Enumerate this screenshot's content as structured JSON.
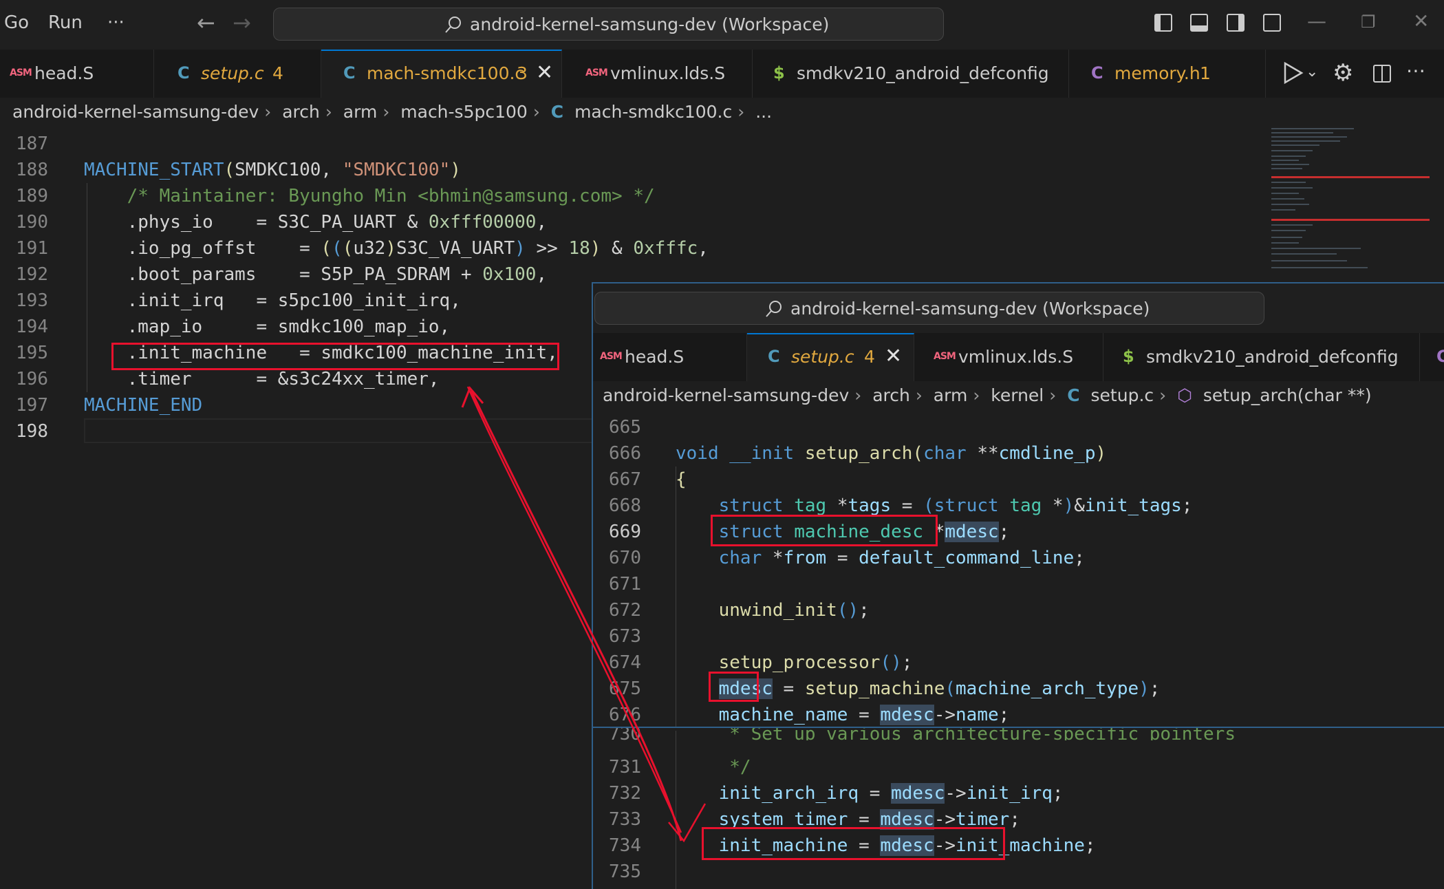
{
  "titlebar": {
    "menu": [
      "Go",
      "Run",
      "···"
    ],
    "back_icon": "arrow-left-icon",
    "forward_icon": "arrow-right-icon",
    "search_text": "android-kernel-samsung-dev (Workspace)"
  },
  "main_editor": {
    "tabs": [
      {
        "icon": "ASM",
        "label": "head.S",
        "badge": ""
      },
      {
        "icon": "C",
        "label": "setup.c",
        "badge": "4"
      },
      {
        "icon": "C",
        "label": "mach-smdkc100.c",
        "badge": "3"
      },
      {
        "icon": "ASM",
        "label": "vmlinux.lds.S",
        "badge": ""
      },
      {
        "icon": "$",
        "label": "smdkv210_android_defconfig",
        "badge": ""
      },
      {
        "icon": "C",
        "label": "memory.h",
        "badge": "1"
      }
    ],
    "breadcrumbs": [
      "android-kernel-samsung-dev",
      "arch",
      "arm",
      "mach-s5pc100",
      "C",
      "mach-smdkc100.c",
      "..."
    ],
    "line_numbers": [
      "187",
      "188",
      "189",
      "190",
      "191",
      "192",
      "193",
      "194",
      "195",
      "196",
      "197",
      "198"
    ]
  },
  "overlay_editor": {
    "search_text": "android-kernel-samsung-dev (Workspace)",
    "tabs": [
      {
        "icon": "ASM",
        "label": "head.S",
        "badge": ""
      },
      {
        "icon": "C",
        "label": "setup.c",
        "badge": "4"
      },
      {
        "icon": "ASM",
        "label": "vmlinux.lds.S",
        "badge": ""
      },
      {
        "icon": "$",
        "label": "smdkv210_android_defconfig",
        "badge": ""
      }
    ],
    "breadcrumbs": [
      "android-kernel-samsung-dev",
      "arch",
      "arm",
      "kernel",
      "C",
      "setup.c",
      "setup_arch(char **)"
    ],
    "line_numbers": [
      "665",
      "666",
      "667",
      "668",
      "669",
      "670",
      "671",
      "672",
      "673",
      "674",
      "675",
      "676",
      "730",
      "731",
      "732",
      "733",
      "734",
      "735"
    ]
  },
  "colors": {
    "background": "#1e1e1e",
    "annotation_red": "#e8112d",
    "keyword": "#569cd6",
    "function": "#dcdcaa",
    "variable": "#9cdcfe",
    "type": "#4ec9b0",
    "number": "#b5cea8",
    "string": "#ce9178",
    "comment": "#6a9955"
  }
}
